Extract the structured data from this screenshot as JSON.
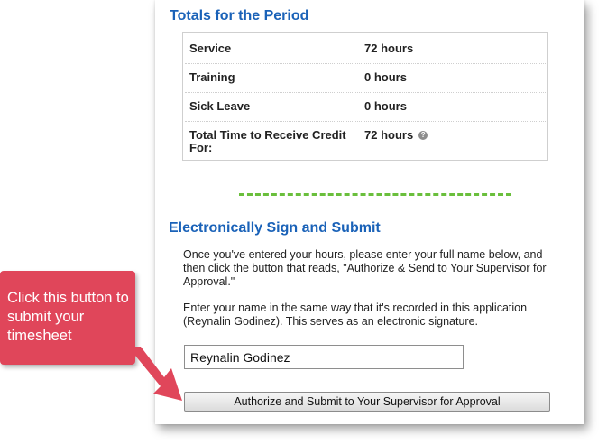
{
  "totals": {
    "title": "Totals for the Period",
    "rows": [
      {
        "label": "Service",
        "value": "72 hours"
      },
      {
        "label": "Training",
        "value": "0 hours"
      },
      {
        "label": "Sick Leave",
        "value": "0 hours"
      },
      {
        "label": "Total Time to Receive Credit For:",
        "value": "72 hours"
      }
    ],
    "help_icon": "question-icon"
  },
  "sign": {
    "title": "Electronically Sign and Submit",
    "instruction_1": "Once you've entered your hours, please enter your full name below, and then click the button that reads, \"Authorize & Send to Your Supervisor for Approval.\"",
    "instruction_2": "Enter your name in the same way that it's recorded in this application (Reynalin Godinez). This serves as an electronic signature.",
    "name_value": "Reynalin Godinez",
    "submit_label": "Authorize and Submit to Your Supervisor for Approval"
  },
  "callout": {
    "text": "Click this button to submit your timesheet",
    "color": "#e0465a"
  },
  "colors": {
    "title": "#1a62b8",
    "divider": "#6abf3c"
  }
}
